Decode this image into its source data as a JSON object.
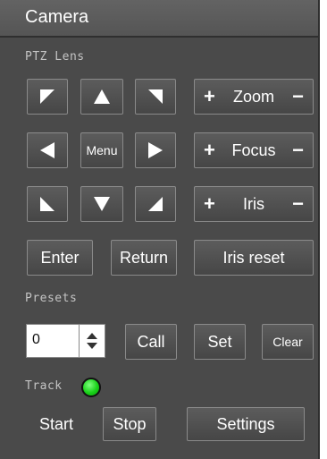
{
  "window": {
    "title": "Camera"
  },
  "lens": {
    "section_label": "PTZ Lens",
    "menu_label": "Menu",
    "zoom": {
      "plus": "+",
      "label": "Zoom",
      "minus": "−"
    },
    "focus": {
      "plus": "+",
      "label": "Focus",
      "minus": "−"
    },
    "iris": {
      "plus": "+",
      "label": "Iris",
      "minus": "−"
    },
    "enter_label": "Enter",
    "return_label": "Return",
    "iris_reset_label": "Iris reset"
  },
  "presets": {
    "section_label": "Presets",
    "value": "0",
    "call_label": "Call",
    "set_label": "Set",
    "clear_label": "Clear"
  },
  "track": {
    "label": "Track",
    "status_color": "#19d119",
    "start_label": "Start",
    "stop_label": "Stop",
    "settings_label": "Settings"
  },
  "icons": {
    "pan_up_left": "arrow-up-left-icon",
    "pan_up": "arrow-up-icon",
    "pan_up_right": "arrow-up-right-icon",
    "pan_left": "arrow-left-icon",
    "pan_right": "arrow-right-icon",
    "pan_down_left": "arrow-down-left-icon",
    "pan_down": "arrow-down-icon",
    "pan_down_right": "arrow-down-right-icon",
    "spinner": "spinner-arrows-icon"
  }
}
